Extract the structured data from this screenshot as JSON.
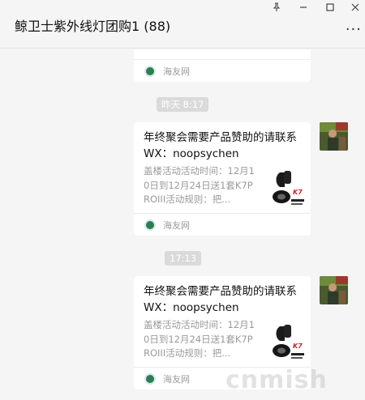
{
  "window": {
    "title": "鲸卫士紫外线灯团购1 (88)",
    "controls": [
      "pin-icon",
      "minimize-icon",
      "maximize-icon",
      "close-icon"
    ],
    "more_label": "···"
  },
  "messages": {
    "top_card": {
      "source": "海友网"
    },
    "timestamps": [
      "昨天 8:17",
      "17:13"
    ],
    "card_1": {
      "title": "年终聚会需要产品赞助的请联系WX：noopsychen",
      "desc": "盖楼活动活动时间：12月10日到12月24日送1套K7PROIII活动规则：把...",
      "source": "海友网"
    },
    "card_2": {
      "title": "年终聚会需要产品赞助的请联系WX：noopsychen",
      "desc": "盖楼活动活动时间：12月10日到12月24日送1套K7PROIII活动规则：把...",
      "source": "海友网"
    }
  },
  "watermark": "cnmish",
  "colors": {
    "background": "#f5f5f5",
    "card": "#ffffff",
    "time_pill": "#dadada",
    "source_icon": "#2e7d4f"
  }
}
